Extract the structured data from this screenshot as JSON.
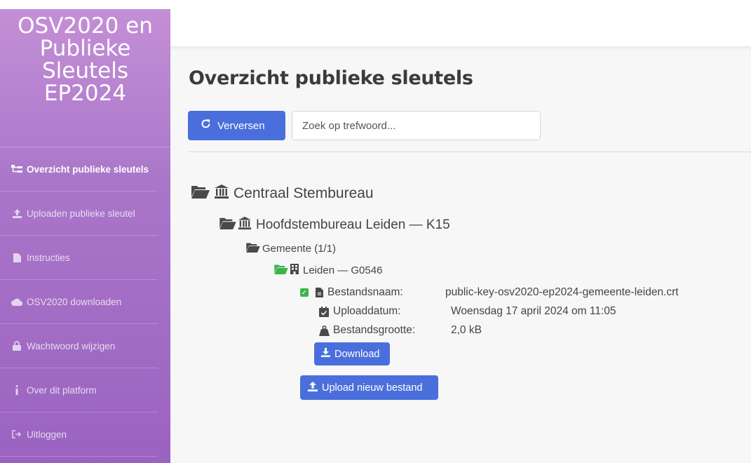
{
  "sidebar": {
    "brand_lines": [
      "OSV2020 en",
      "Publieke",
      "Sleutels",
      "EP2024"
    ],
    "items": [
      {
        "label": "Overzicht publieke sleutels",
        "icon": "sitemap-icon",
        "active": true
      },
      {
        "label": "Uploaden publieke sleutel",
        "icon": "upload-icon",
        "active": false
      },
      {
        "label": "Instructies",
        "icon": "file-icon",
        "active": false
      },
      {
        "label": "OSV2020 downloaden",
        "icon": "cloud-download-icon",
        "active": false
      },
      {
        "label": "Wachtwoord wijzigen",
        "icon": "lock-icon",
        "active": false
      },
      {
        "label": "Over dit platform",
        "icon": "info-icon",
        "active": false
      },
      {
        "label": "Uitloggen",
        "icon": "logout-icon",
        "active": false
      }
    ]
  },
  "main": {
    "title": "Overzicht publieke sleutels",
    "refresh_label": "Verversen",
    "search_placeholder": "Zoek op trefwoord...",
    "tree": {
      "level1": "Centraal Stembureau",
      "level2": "Hoofdstembureau Leiden — K15",
      "level3": "Gemeente (1/1)",
      "level4": "Leiden — G0546"
    },
    "details": [
      {
        "label": "Bestandsnaam:",
        "value": "public-key-osv2020-ep2024-gemeente-leiden.crt",
        "icon": "file-icon"
      },
      {
        "label": "Uploaddatum:",
        "value": "Woensdag 17 april 2024 om 11:05",
        "icon": "calendar-check-icon"
      },
      {
        "label": "Bestandsgrootte:",
        "value": "2,0 kB",
        "icon": "weight-icon"
      }
    ],
    "download_label": "Download",
    "upload_label": "Upload nieuw bestand"
  },
  "colors": {
    "sidebar_top": "#c48fd6",
    "sidebar_bottom": "#9b63c0",
    "primary_button": "#4a6fdc",
    "success": "#3bb54a"
  }
}
